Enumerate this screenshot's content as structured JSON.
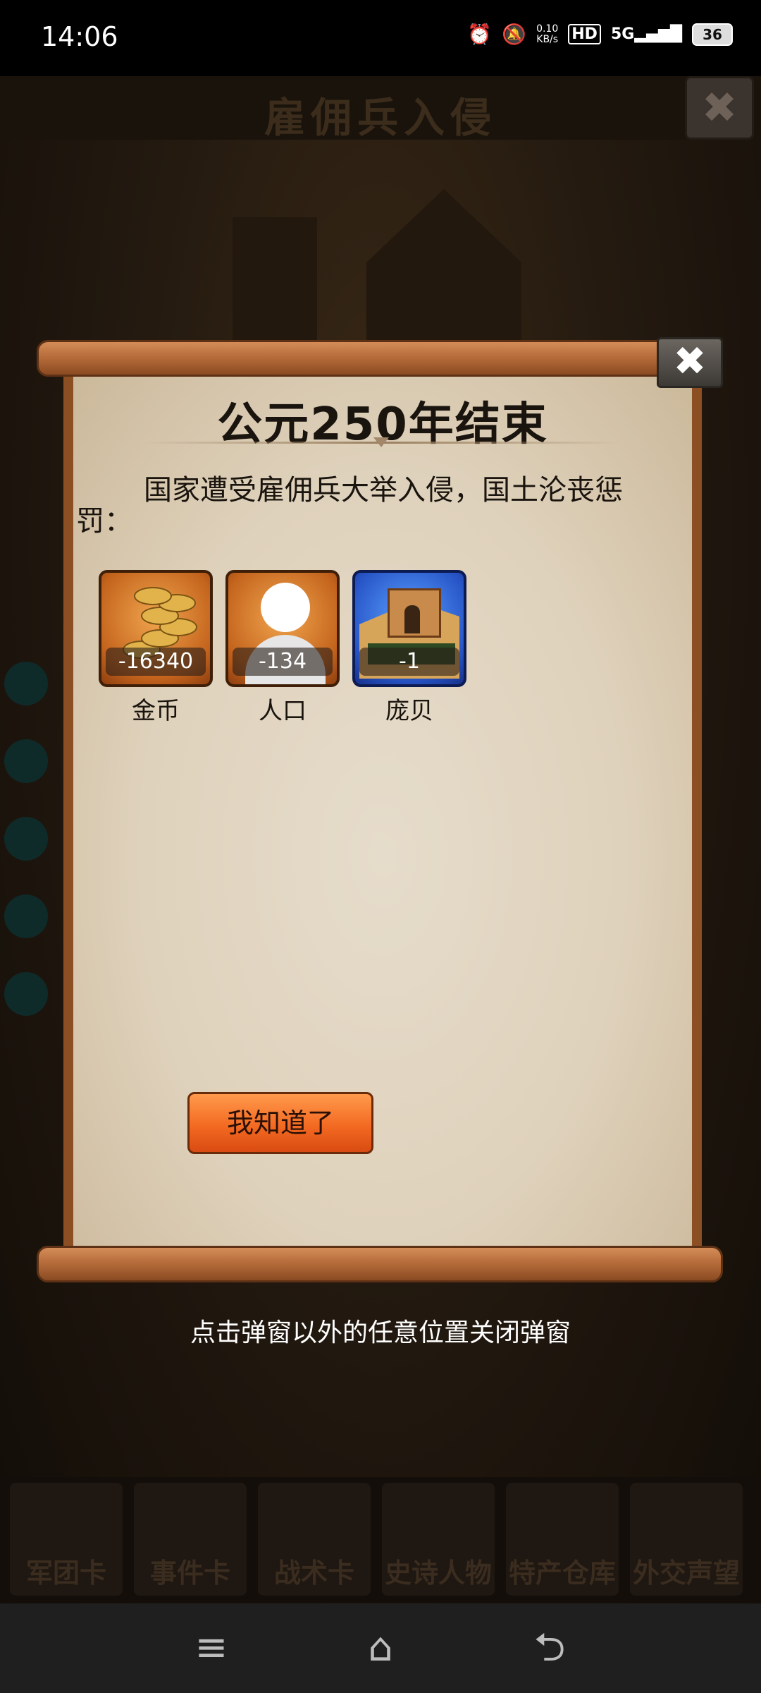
{
  "status_bar": {
    "time": "14:06",
    "net_speed_value": "0.10",
    "net_speed_unit": "KB/s",
    "hd_label": "HD",
    "signal_label": "5G",
    "battery": "36",
    "icons": [
      "alarm-icon",
      "mute-icon",
      "signal-icon",
      "battery-icon"
    ]
  },
  "background": {
    "title": "雇佣兵入侵",
    "close_icon": "✖",
    "bottom_tabs": [
      "军团卡",
      "事件卡",
      "战术卡",
      "史诗人物",
      "特产仓库",
      "外交声望"
    ]
  },
  "popup": {
    "title": "公元250年结束",
    "message": "国家遭受雇佣兵大举入侵，国土沦丧惩罚：",
    "close_icon": "✖",
    "rewards": [
      {
        "label": "金币",
        "value": "-16340",
        "icon": "gold-coins-icon"
      },
      {
        "label": "人口",
        "value": "-134",
        "icon": "population-icon"
      },
      {
        "label": "庞贝",
        "value": "-1",
        "icon": "city-icon"
      }
    ],
    "confirm_button": "我知道了"
  },
  "hint": "点击弹窗以外的任意位置关闭弹窗",
  "nav_bar": {
    "menu_icon": "≡",
    "home_icon": "⌂",
    "back_icon": "⮌"
  }
}
